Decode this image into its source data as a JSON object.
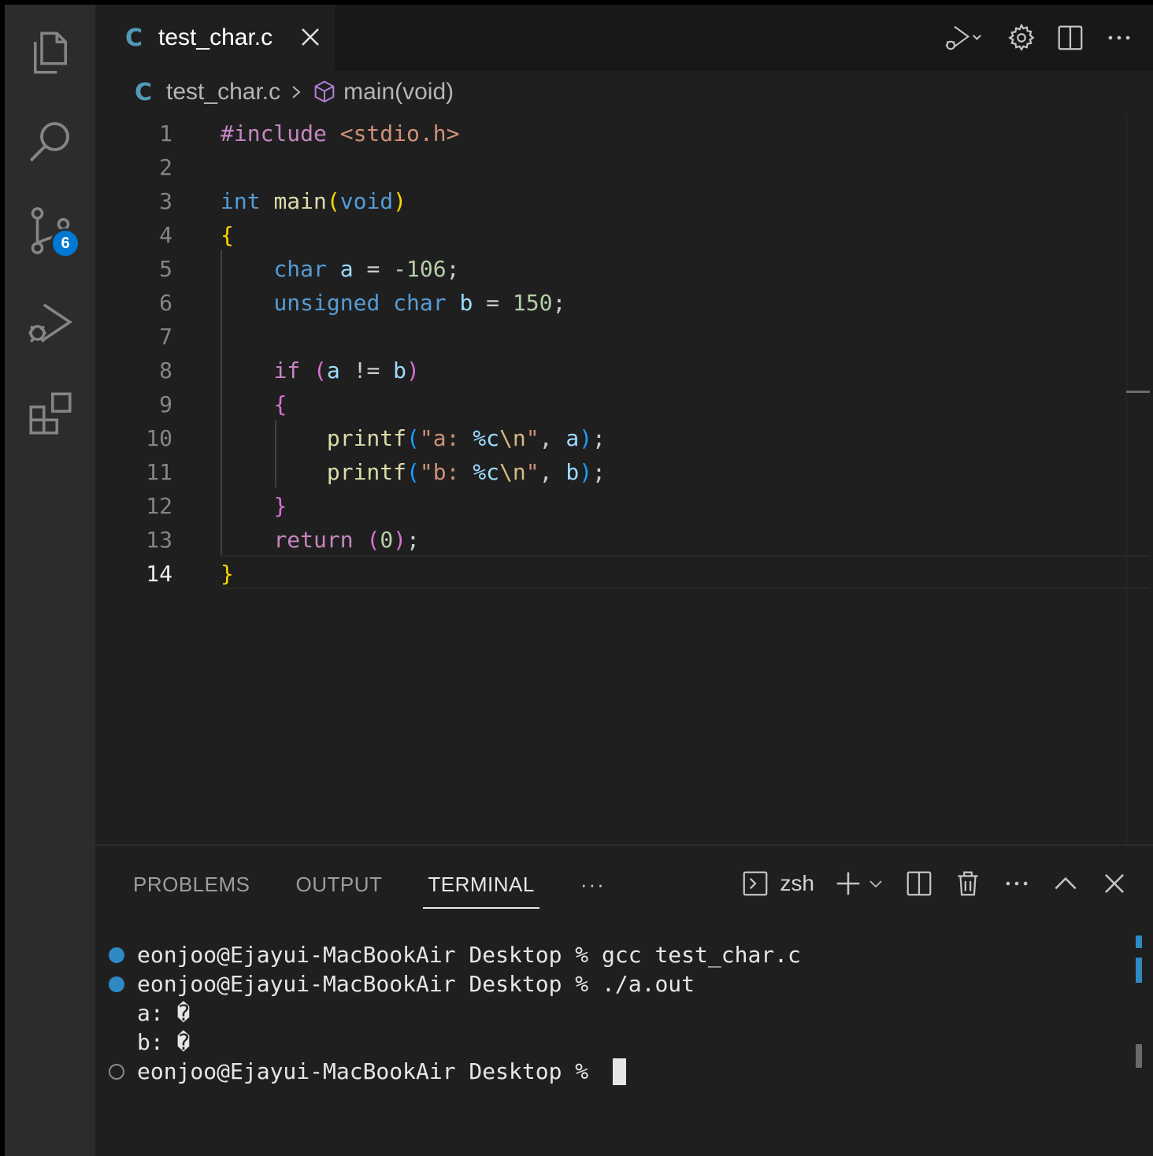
{
  "activity_bar": {
    "items": [
      "explorer-icon",
      "search-icon",
      "source-control-icon",
      "run-debug-icon",
      "extensions-icon"
    ],
    "source_control_badge": "6",
    "badge_color": "#0078d4"
  },
  "tab": {
    "icon_glyph": "C",
    "title": "test_char.c"
  },
  "breadcrumbs": {
    "icon_glyph": "C",
    "file": "test_char.c",
    "symbol": "main(void)"
  },
  "editor": {
    "line_numbers": [
      "1",
      "2",
      "3",
      "4",
      "5",
      "6",
      "7",
      "8",
      "9",
      "10",
      "11",
      "12",
      "13",
      "14"
    ],
    "active_line": "14",
    "lines": [
      "#include <stdio.h>",
      "",
      "int main(void)",
      "{",
      "    char a = -106;",
      "    unsigned char b = 150;",
      "",
      "    if (a != b)",
      "    {",
      "        printf(\"a: %c\\n\", a);",
      "        printf(\"b: %c\\n\", b);",
      "    }",
      "    return (0);",
      "}"
    ]
  },
  "panel": {
    "tabs": [
      "PROBLEMS",
      "OUTPUT",
      "TERMINAL"
    ],
    "active_tab": "TERMINAL",
    "more": "···",
    "shell": "zsh"
  },
  "terminal": {
    "lines": [
      {
        "marker": "blue",
        "text": "eonjoo@Ejayui-MacBookAir Desktop % gcc test_char.c"
      },
      {
        "marker": "blue",
        "text": "eonjoo@Ejayui-MacBookAir Desktop % ./a.out"
      },
      {
        "marker": "none",
        "text": "a: �"
      },
      {
        "marker": "none",
        "text": "b: �"
      },
      {
        "marker": "empty",
        "text": "eonjoo@Ejayui-MacBookAir Desktop % "
      }
    ]
  },
  "colors": {
    "accent": "#0078d4",
    "c_file_icon": "#519aba",
    "success_marker": "#2f89c5"
  }
}
